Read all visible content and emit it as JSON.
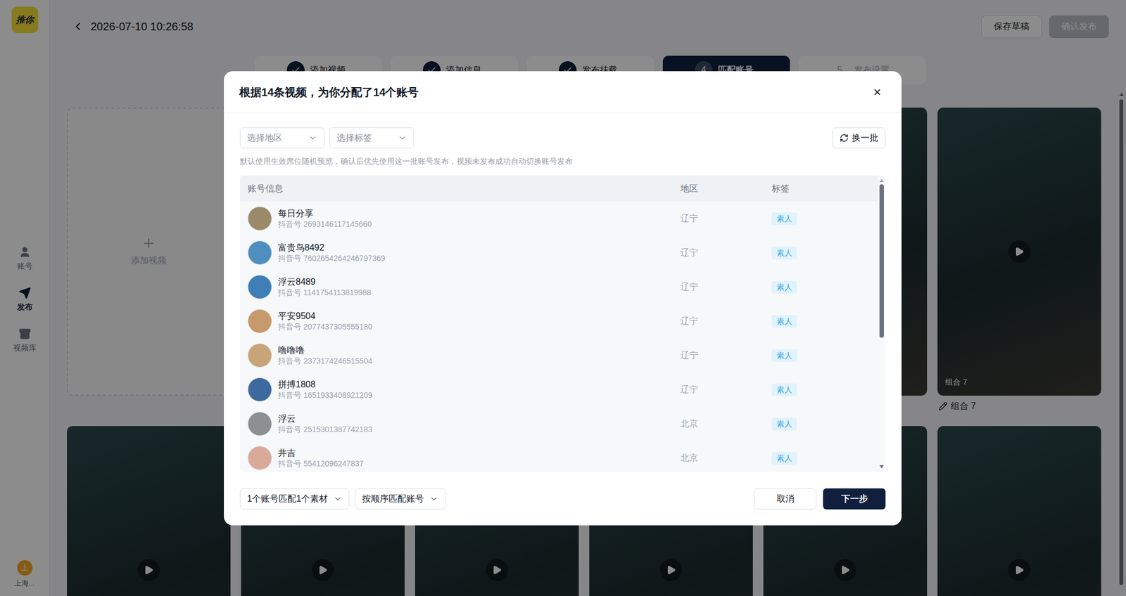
{
  "sidebar": {
    "logo": "推你",
    "items": [
      {
        "label": "账号",
        "selected": false
      },
      {
        "label": "发布",
        "selected": true
      },
      {
        "label": "视频库",
        "selected": false
      }
    ],
    "user": {
      "avatar": "上",
      "name": "上海..."
    }
  },
  "header": {
    "title": "2026-07-10 10:26:58",
    "buttons": [
      {
        "label": "保存草稿",
        "kind": "secondary",
        "disabled": false
      },
      {
        "label": "确认发布",
        "kind": "primary",
        "disabled": true
      }
    ]
  },
  "steps": [
    {
      "number": "",
      "label": "添加视频",
      "done": true,
      "selected": false
    },
    {
      "number": "",
      "label": "添加信息",
      "done": true,
      "selected": false
    },
    {
      "number": "",
      "label": "发布挂载",
      "done": true,
      "selected": false
    },
    {
      "number": "4",
      "label": "匹配账号",
      "done": false,
      "selected": true
    },
    {
      "number": "5",
      "label": "发布设置",
      "done": false,
      "selected": false
    }
  ],
  "board": {
    "add_video": "添加视频",
    "featured": {
      "caption": "组合 7",
      "label": "组合 7"
    }
  },
  "dialog": {
    "title": "根据14条视频，为你分配了14个账号",
    "close": "×",
    "filters": [
      {
        "placeholder": "选择地区"
      },
      {
        "placeholder": "选择标签"
      }
    ],
    "refresh": "换一批",
    "hint": "默认使用生效席位随机预览，确认后优先使用这一批账号发布，视频未发布成功自动切换账号发布",
    "columns": [
      "账号信息",
      "地区",
      "标签"
    ],
    "rows": [
      {
        "name": "每日分享",
        "id": "抖音号 2693146117145660",
        "region": "辽宁",
        "tag": "素人",
        "color": "#9a8a6a"
      },
      {
        "name": "富贵鸟8492",
        "id": "抖音号 7602654264246797369",
        "region": "辽宁",
        "tag": "素人",
        "color": "#4f8fc0"
      },
      {
        "name": "浮云8489",
        "id": "抖音号 1141754113819988",
        "region": "辽宁",
        "tag": "素人",
        "color": "#3f7fb8"
      },
      {
        "name": "平安9504",
        "id": "抖音号 2077437305555180",
        "region": "辽宁",
        "tag": "素人",
        "color": "#c69a6c"
      },
      {
        "name": "噜噜噜",
        "id": "抖音号 2373174246515504",
        "region": "辽宁",
        "tag": "素人",
        "color": "#c8a578"
      },
      {
        "name": "拼搏1808",
        "id": "抖音号 1651933408921209",
        "region": "辽宁",
        "tag": "素人",
        "color": "#3d6a9e"
      },
      {
        "name": "浮云",
        "id": "抖音号 2515301387742183",
        "region": "北京",
        "tag": "素人",
        "color": "#8d8f93"
      },
      {
        "name": "井吉",
        "id": "抖音号 55412096247837",
        "region": "北京",
        "tag": "素人",
        "color": "#d9a99a"
      }
    ],
    "scroll": {
      "level": 0.55
    },
    "footer_selects": [
      "1个账号匹配1个素材",
      "按顺序匹配账号"
    ],
    "buttons": [
      {
        "label": "取消",
        "kind": "secondary"
      },
      {
        "label": "下一步",
        "kind": "primary"
      }
    ]
  }
}
